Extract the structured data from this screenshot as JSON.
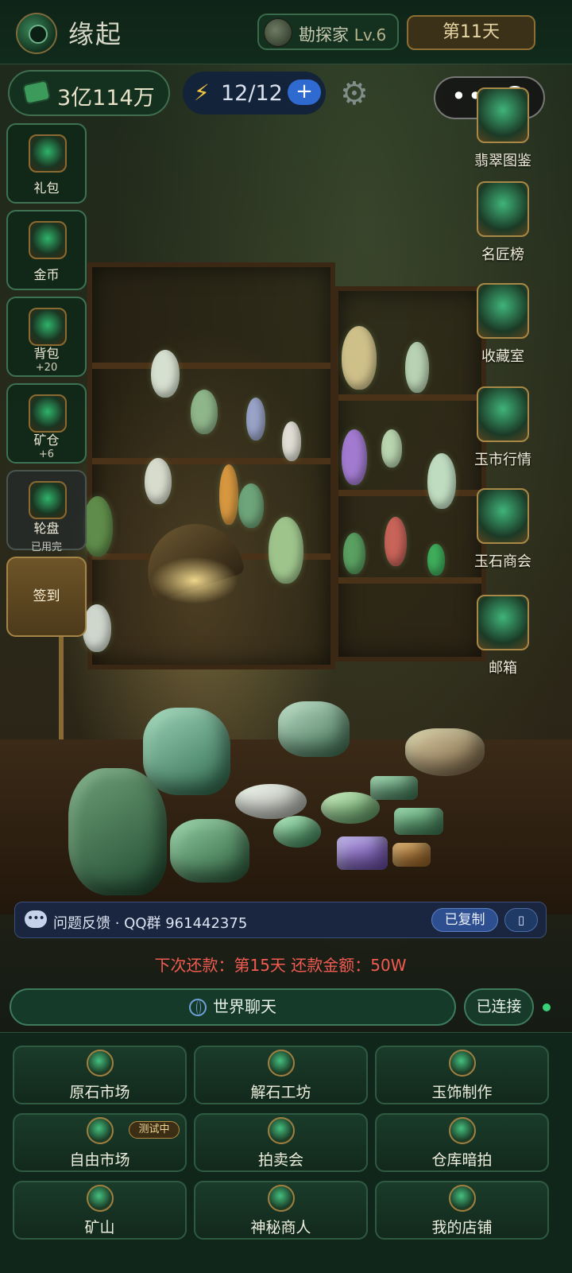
{
  "header": {
    "title": "缘起",
    "rank_name": "勘探家",
    "rank_level": "Lv.6",
    "day": "第11天"
  },
  "resources": {
    "money": "3亿114万",
    "energy": "12/12",
    "energy_plus": "+"
  },
  "left_menu": [
    {
      "label": "礼包",
      "sub": ""
    },
    {
      "label": "金币",
      "sub": ""
    },
    {
      "label": "背包",
      "sub": "+20"
    },
    {
      "label": "矿仓",
      "sub": "+6"
    },
    {
      "label": "轮盘",
      "sub": "已用完"
    }
  ],
  "sign_in": "签到",
  "right_menu": [
    {
      "label": "翡翠图鉴"
    },
    {
      "label": "名匠榜"
    },
    {
      "label": "收藏室"
    },
    {
      "label": "玉市行情"
    },
    {
      "label": "玉石商会"
    },
    {
      "label": "邮箱"
    }
  ],
  "feedback": {
    "text": "问题反馈 · QQ群 961442375",
    "copied_label": "已复制",
    "copy_icon_glyph": "▯"
  },
  "repayment_notice": "下次还款：第15天 还款金额：50W",
  "chat": {
    "world_chat_label": "世界聊天",
    "connection_label": "已连接"
  },
  "grid": [
    {
      "label": "原石市场",
      "badge": ""
    },
    {
      "label": "解石工坊",
      "badge": ""
    },
    {
      "label": "玉饰制作",
      "badge": ""
    },
    {
      "label": "自由市场",
      "badge": "测试中"
    },
    {
      "label": "拍卖会",
      "badge": ""
    },
    {
      "label": "仓库暗拍",
      "badge": ""
    },
    {
      "label": "矿山",
      "badge": ""
    },
    {
      "label": "神秘商人",
      "badge": ""
    },
    {
      "label": "我的店铺",
      "badge": ""
    }
  ],
  "colors": {
    "accent_green": "#3d7252",
    "gold": "#a58447",
    "warning_red": "#f25b52",
    "chat_blue": "#2d4f8f"
  }
}
